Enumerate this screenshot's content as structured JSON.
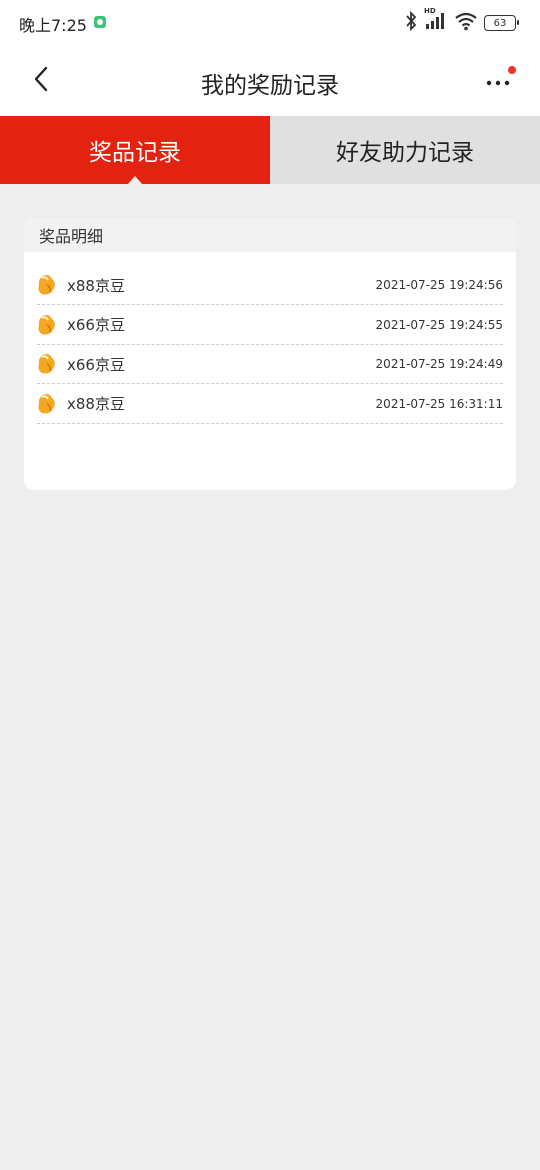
{
  "status_bar": {
    "time": "晚上7:25",
    "battery": "63",
    "hd_label": "HD"
  },
  "nav": {
    "title": "我的奖励记录"
  },
  "tabs": [
    {
      "label": "奖品记录",
      "active": true
    },
    {
      "label": "好友助力记录",
      "active": false
    }
  ],
  "card": {
    "header": "奖品明细",
    "items": [
      {
        "prize": "x88京豆",
        "time": "2021-07-25 19:24:56"
      },
      {
        "prize": "x66京豆",
        "time": "2021-07-25 19:24:55"
      },
      {
        "prize": "x66京豆",
        "time": "2021-07-25 19:24:49"
      },
      {
        "prize": "x88京豆",
        "time": "2021-07-25 16:31:11"
      }
    ]
  },
  "colors": {
    "accent": "#e3230f",
    "notification_dot": "#f0302a",
    "bean": "#f5a623"
  },
  "icons": [
    "back-arrow-icon",
    "more-dots-icon",
    "bluetooth-icon",
    "signal-icon",
    "wifi-icon",
    "battery-icon",
    "bean-icon"
  ]
}
